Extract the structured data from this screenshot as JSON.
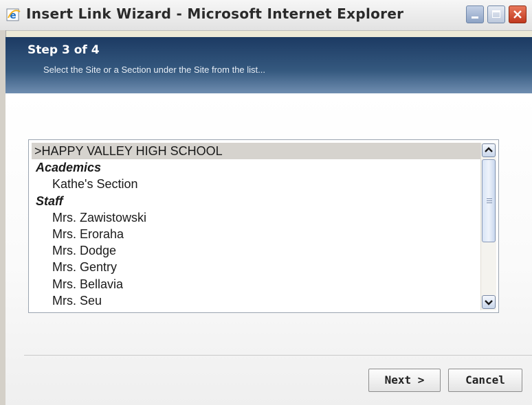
{
  "window": {
    "title": "Insert Link Wizard - Microsoft Internet Explorer",
    "icon": "ie-icon",
    "controls": [
      "minimize-icon",
      "maximize-icon",
      "close-icon"
    ]
  },
  "header": {
    "step": "Step 3 of 4",
    "description": "Select the Site or a Section under the Site from the list..."
  },
  "listbox": {
    "items": [
      {
        "label": ">HAPPY VALLEY HIGH SCHOOL"
      },
      {
        "label": "Academics"
      },
      {
        "label": "Kathe's Section"
      },
      {
        "label": "Staff"
      },
      {
        "label": "Mrs. Zawistowski"
      },
      {
        "label": "Mrs. Eroraha"
      },
      {
        "label": "Mrs. Dodge"
      },
      {
        "label": "Mrs. Gentry"
      },
      {
        "label": "Mrs. Bellavia"
      },
      {
        "label": "Mrs. Seu"
      }
    ]
  },
  "buttons": {
    "next": "Next >",
    "cancel": "Cancel"
  },
  "colors": {
    "header_dark": "#1c3a63",
    "header_light": "#6f8db0",
    "close_button": "#c0381e",
    "selected_row": "#d6d3ce"
  }
}
